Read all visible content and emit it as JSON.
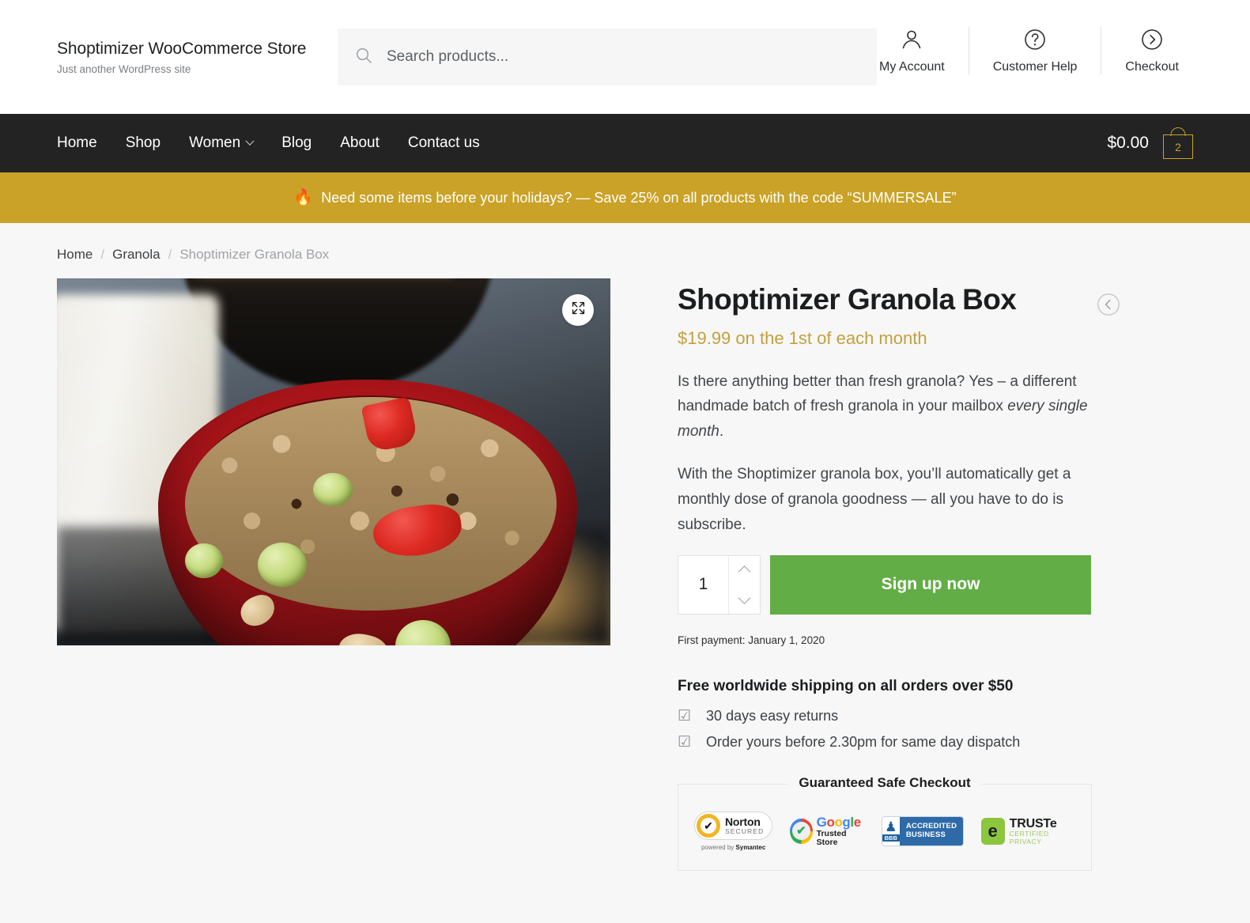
{
  "header": {
    "brand_title": "Shoptimizer WooCommerce Store",
    "brand_tagline": "Just another WordPress site",
    "search_placeholder": "Search products...",
    "search_value": "",
    "search_icon": "search-icon",
    "actions": [
      {
        "label": "My Account",
        "icon": "user-icon"
      },
      {
        "label": "Customer Help",
        "icon": "question-circle-icon"
      },
      {
        "label": "Checkout",
        "icon": "arrow-right-circle-icon"
      }
    ]
  },
  "nav": {
    "items": [
      {
        "label": "Home",
        "has_dropdown": false
      },
      {
        "label": "Shop",
        "has_dropdown": false
      },
      {
        "label": "Women",
        "has_dropdown": true
      },
      {
        "label": "Blog",
        "has_dropdown": false
      },
      {
        "label": "About",
        "has_dropdown": false
      },
      {
        "label": "Contact us",
        "has_dropdown": false
      }
    ],
    "cart_total": "$0.00",
    "cart_count": "2",
    "cart_icon": "shopping-bag-icon",
    "accent_color": "#c9a227",
    "background_color": "#232323"
  },
  "promo": {
    "emoji": "🔥",
    "text": "Need some items before your holidays? — Save 25% on all products with the code “SUMMERSALE”",
    "background_color": "#c9a227"
  },
  "breadcrumb": {
    "home": "Home",
    "category": "Granola",
    "current": "Shoptimizer Granola Box",
    "separator": "/"
  },
  "gallery": {
    "zoom_icon": "expand-arrows-icon",
    "alt": "Red bowl of granola with green grapes, strawberries and cashews beside a glass of milk"
  },
  "product": {
    "title": "Shoptimizer Granola Box",
    "price": "$19.99 on the 1st of each month",
    "price_color": "#c4a03c",
    "prev_icon": "chevron-left-circle-icon",
    "description_p1_a": "Is there anything better than fresh granola? Yes – a different handmade batch of fresh granola in your mailbox ",
    "description_p1_em": "every single month",
    "description_p1_b": ".",
    "description_p2": "With the Shoptimizer granola box, you’ll automatically get a monthly dose of granola goodness — all you have to do is subscribe.",
    "quantity": "1",
    "qty_up_icon": "chevron-up-icon",
    "qty_down_icon": "chevron-down-icon",
    "signup_label": "Sign up now",
    "signup_color": "#63ad47",
    "first_payment": "First payment: January 1, 2020",
    "shipping_heading": "Free worldwide shipping on all orders over $50",
    "features": [
      {
        "tick": "☑",
        "label": "30 days easy returns"
      },
      {
        "tick": "☑",
        "label": "Order yours before 2.30pm for same day dispatch"
      }
    ]
  },
  "safe_checkout": {
    "title": "Guaranteed Safe Checkout",
    "badges": [
      {
        "name": "Norton",
        "line1": "Norton",
        "line2": "SECURED",
        "sub_prefix": "powered by ",
        "sub_brand": "Symantec",
        "check": "✔"
      },
      {
        "name": "Google Trusted Store",
        "word_letters": [
          "G",
          "o",
          "o",
          "g",
          "l",
          "e"
        ],
        "sub": "Trusted Store",
        "check": "✔"
      },
      {
        "name": "BBB Accredited Business",
        "torch": "♟",
        "abbr": "BBB",
        "line1": "ACCREDITED",
        "line2": "BUSINESS"
      },
      {
        "name": "TRUSTe",
        "mark": "e",
        "line1": "TRUSTe",
        "line2": "CERTIFIED PRIVACY"
      }
    ]
  }
}
